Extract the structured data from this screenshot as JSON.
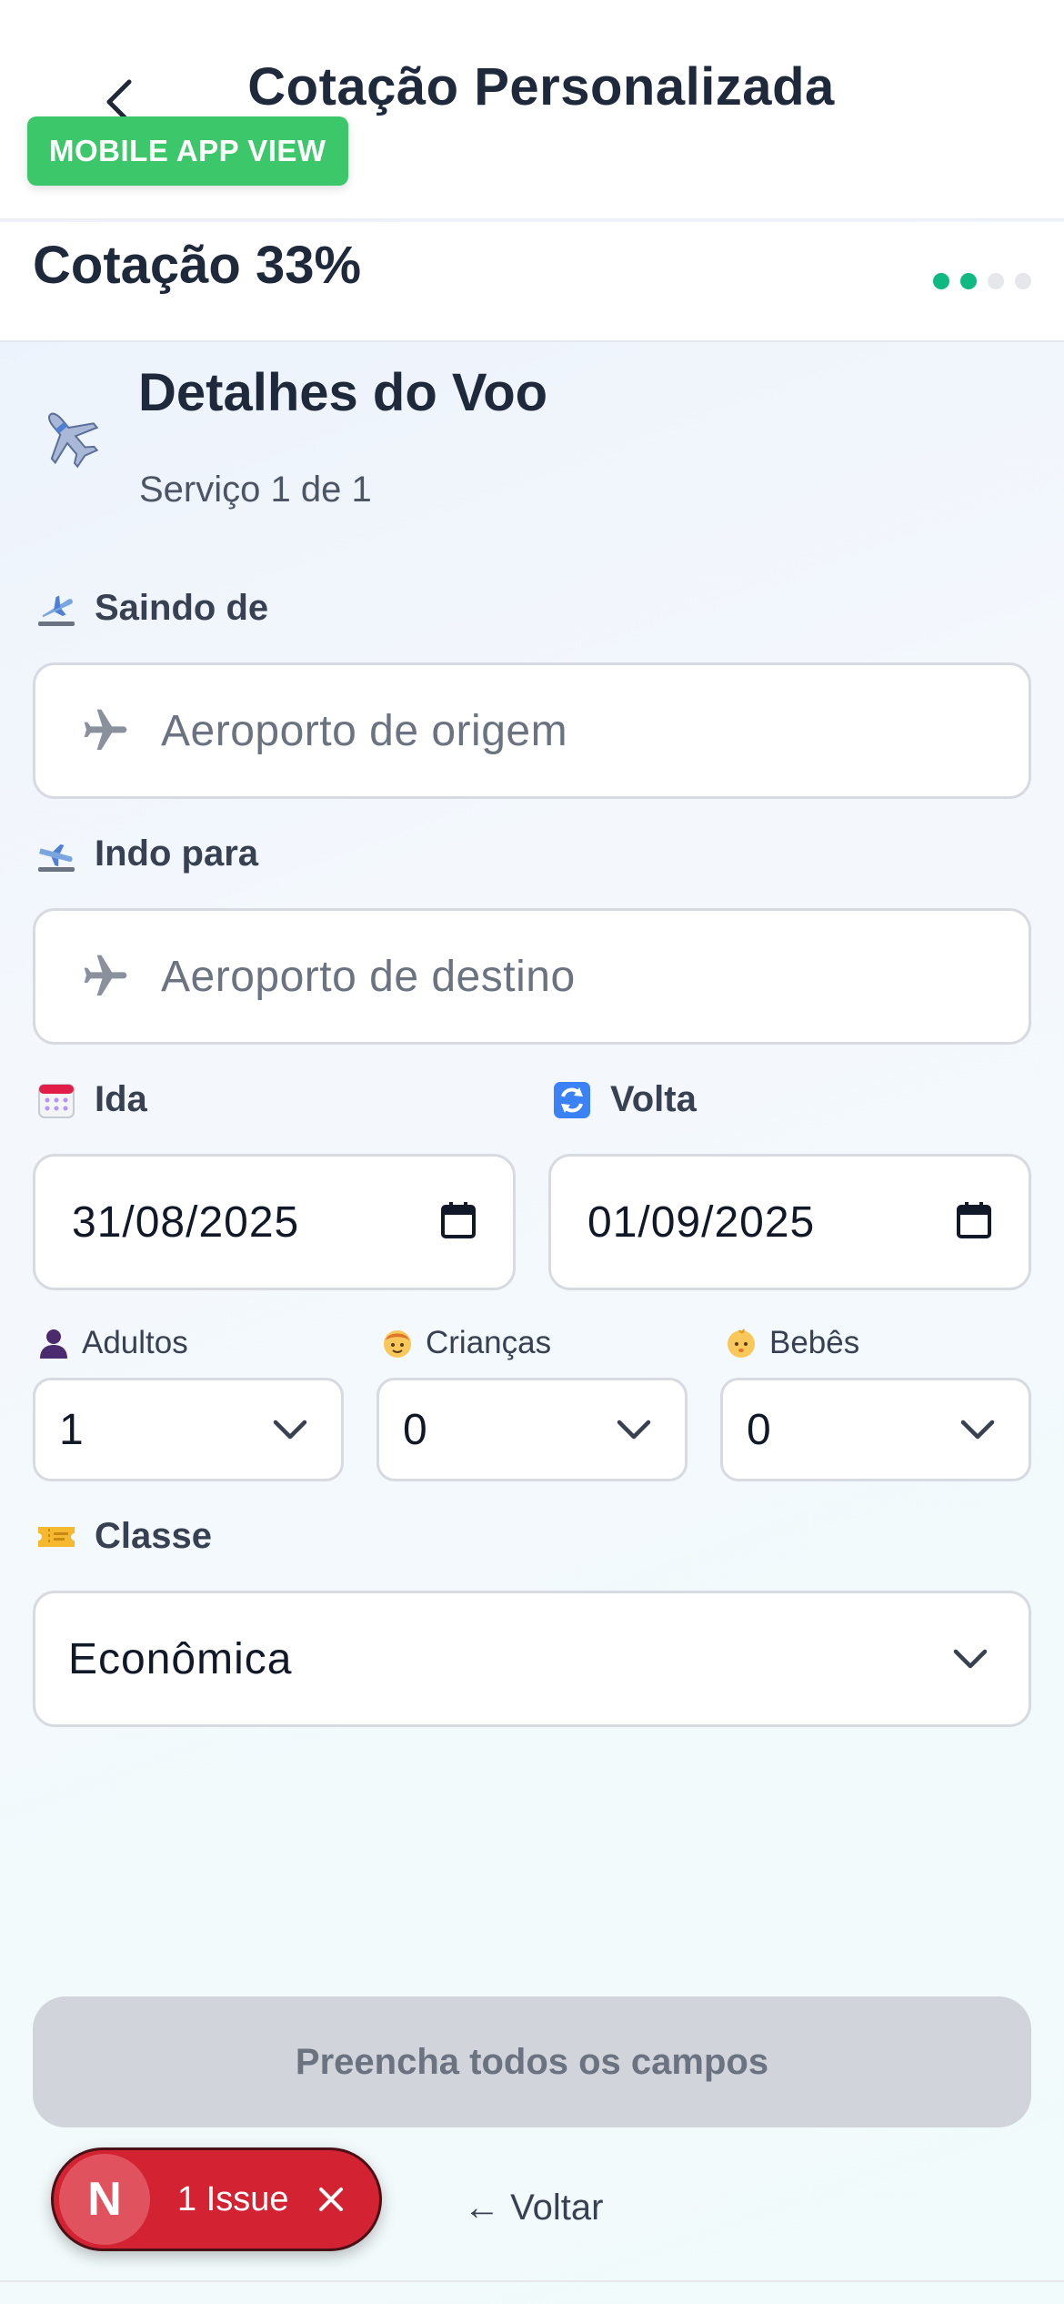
{
  "header": {
    "title": "Cotação Personalizada",
    "badge": "MOBILE APP VIEW"
  },
  "progress": {
    "label": "Cotação 33%",
    "steps_total": 4,
    "steps_done": 2,
    "percent": 33
  },
  "section": {
    "icon": "airplane-icon",
    "title": "Detalhes do Voo",
    "subtitle": "Serviço 1 de 1"
  },
  "form": {
    "origin": {
      "icon": "airplane-departure-icon",
      "label": "Saindo de",
      "placeholder": "Aeroporto de origem"
    },
    "destination": {
      "icon": "airplane-arrival-icon",
      "label": "Indo para",
      "placeholder": "Aeroporto de destino"
    },
    "departure": {
      "icon": "calendar-icon",
      "label": "Ida",
      "value": "31/08/2025"
    },
    "return": {
      "icon": "repeat-icon",
      "label": "Volta",
      "value": "01/09/2025"
    },
    "adults": {
      "icon": "adult-icon",
      "label": "Adultos",
      "value": "1"
    },
    "children": {
      "icon": "child-icon",
      "label": "Crianças",
      "value": "0"
    },
    "infants": {
      "icon": "baby-icon",
      "label": "Bebês",
      "value": "0"
    },
    "class": {
      "icon": "ticket-icon",
      "label": "Classe",
      "value": "Econômica"
    }
  },
  "actions": {
    "submit_label": "Preencha todos os campos",
    "back_label": "← Voltar"
  },
  "issues": {
    "avatar_letter": "N",
    "label": "1 Issue"
  },
  "colors": {
    "accent": "#10b981",
    "badge": "#3cc86a",
    "issue": "#d32232",
    "disabled_button": "#d1d5db"
  }
}
